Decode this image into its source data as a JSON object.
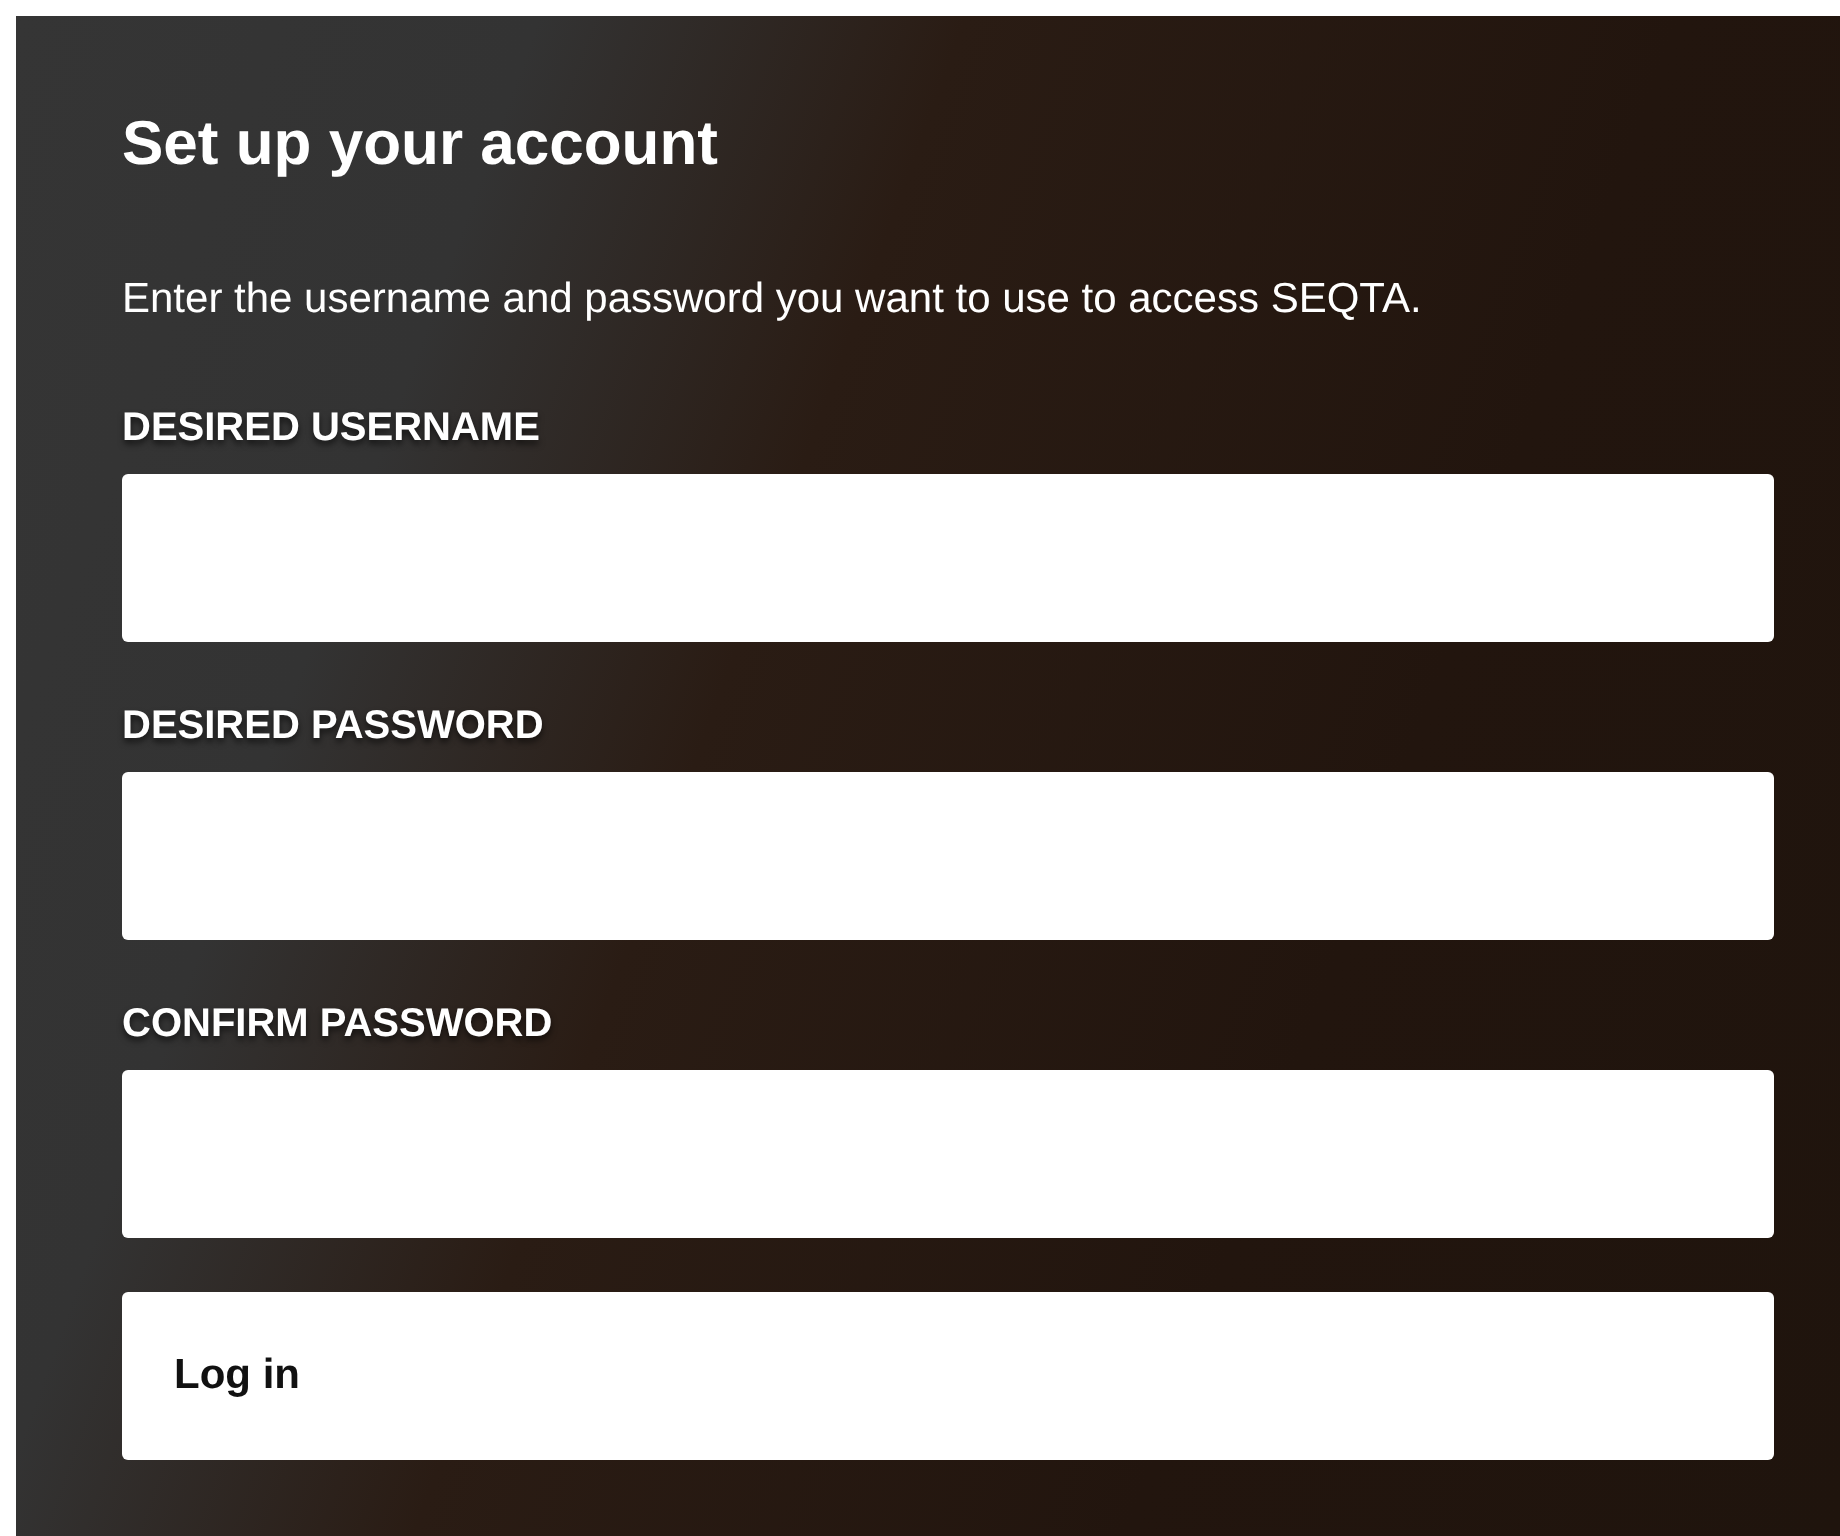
{
  "title": "Set up your account",
  "intro": "Enter the username and password you want to use to access SEQTA.",
  "fields": [
    {
      "label": "DESIRED USERNAME"
    },
    {
      "label": "DESIRED PASSWORD"
    },
    {
      "label": "CONFIRM PASSWORD"
    }
  ],
  "submit": {
    "label": "Log in"
  }
}
